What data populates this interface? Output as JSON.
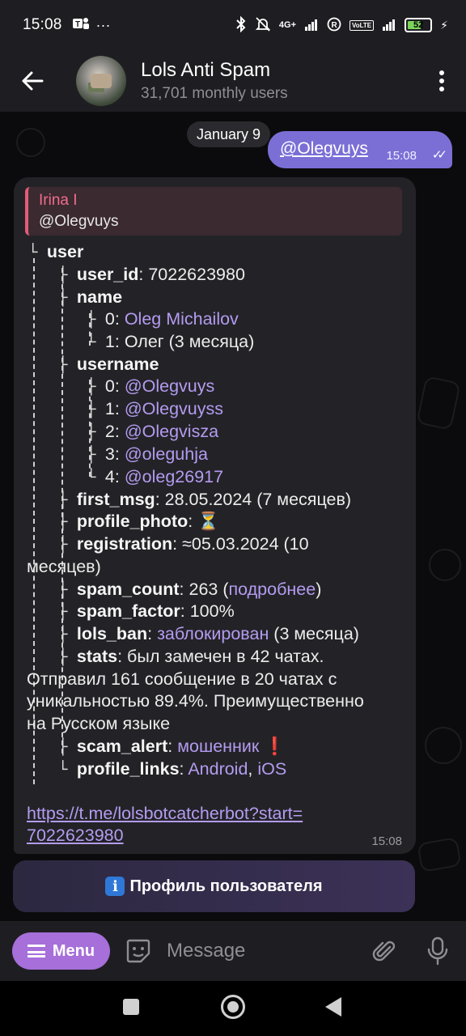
{
  "status_bar": {
    "time": "15:08",
    "network": "4G+",
    "battery": "52",
    "lte_label": "VoLTE"
  },
  "header": {
    "title": "Lols Anti Spam",
    "subtitle": "31,701 monthly users"
  },
  "chat": {
    "date_chip": "January 9",
    "outgoing": {
      "text": "@Olegvuys",
      "time": "15:08"
    },
    "incoming": {
      "reply_name": "Irina I",
      "reply_text": "@Olegvuys",
      "root": "user",
      "user_id_key": "user_id",
      "user_id_val": "7022623980",
      "name_key": "name",
      "name0_idx": "0:",
      "name0": "Oleg Michailov",
      "name1_idx": "1:",
      "name1": "Олег (3 месяца)",
      "username_key": "username",
      "usernames": [
        {
          "idx": "0:",
          "val": "@Olegvuys"
        },
        {
          "idx": "1:",
          "val": "@Olegvuyss"
        },
        {
          "idx": "2:",
          "val": "@Olegvisza"
        },
        {
          "idx": "3:",
          "val": "@oleguhja"
        },
        {
          "idx": "4:",
          "val": "@oleg26917"
        }
      ],
      "first_msg_key": "first_msg",
      "first_msg_val": "28.05.2024 (7 месяцев)",
      "profile_photo_key": "profile_photo",
      "profile_photo_val": "⏳",
      "registration_key": "registration",
      "registration_val1": "≈05.03.2024 (10",
      "registration_val2": "месяцев)",
      "spam_count_key": "spam_count",
      "spam_count_val": "263 (",
      "spam_count_link": "подробнее",
      "spam_count_close": ")",
      "spam_factor_key": "spam_factor",
      "spam_factor_val": "100%",
      "lols_ban_key": "lols_ban",
      "lols_ban_link": "заблокирован",
      "lols_ban_val": " (3 месяца)",
      "stats_key": "stats",
      "stats_val": "был замечен в 42 чатах.",
      "stats_line2": "Отправил 161 сообщение в 20 чатах с",
      "stats_line3": "уникальностью 89.4%. Преимущественно",
      "stats_line4": "на Русском языке",
      "scam_alert_key": "scam_alert",
      "scam_alert_val": "мошенник",
      "scam_alert_emoji": "❗",
      "profile_links_key": "profile_links",
      "profile_link_android": "Android",
      "profile_link_sep": ", ",
      "profile_link_ios": "iOS",
      "url_line1": "https://t.me/lolsbotcatcherbot?start=",
      "url_line2": "7022623980",
      "time": "15:08"
    },
    "keyboard_button": "Профиль пользователя",
    "keyboard_button_icon": "ℹ"
  },
  "composer": {
    "menu_label": "Menu",
    "placeholder": "Message"
  },
  "icons": {
    "back": "arrow-left",
    "more": "three-dots",
    "sticker": "sticker-icon",
    "attach": "paperclip-icon",
    "mic": "microphone-icon"
  },
  "colors": {
    "accent": "#7b6fd6",
    "link": "#b49bf0",
    "menu_button": "#a66fd9",
    "reply_name": "#ef6d8e"
  }
}
